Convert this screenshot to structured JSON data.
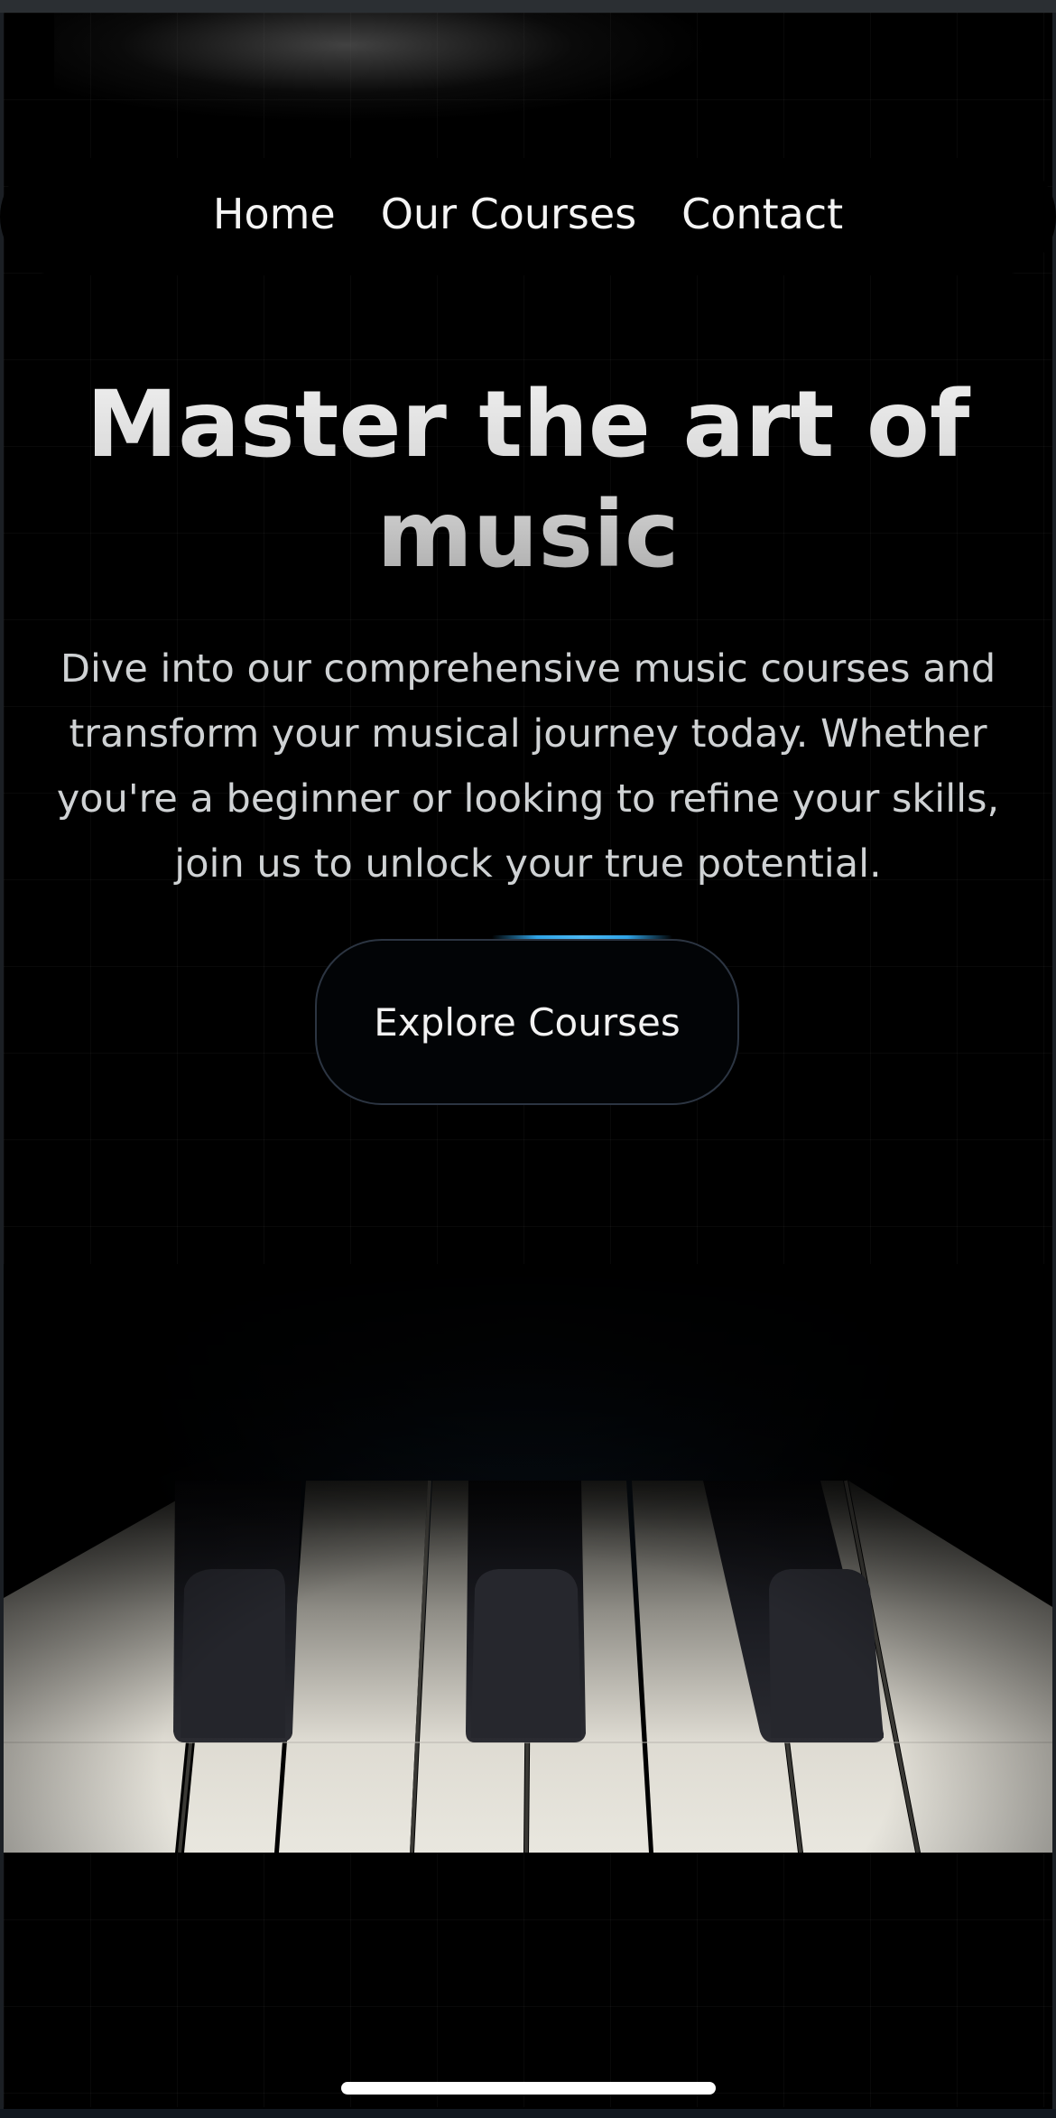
{
  "nav": {
    "items": [
      "Home",
      "Our Courses",
      "Contact"
    ]
  },
  "hero": {
    "title_line1": "Master the art of",
    "title_line2": "music",
    "subtitle": "Dive into our comprehensive music courses and transform your musical journey today. Whether you're a beginner or looking to refine your skills, join us to unlock your true potential.",
    "cta_label": "Explore Courses"
  },
  "media": {
    "hero_image_icon": "piano-keys-image"
  },
  "colors": {
    "background": "#000000",
    "accent_glow": "#2fa3e6",
    "text": "#f2f2f2"
  }
}
